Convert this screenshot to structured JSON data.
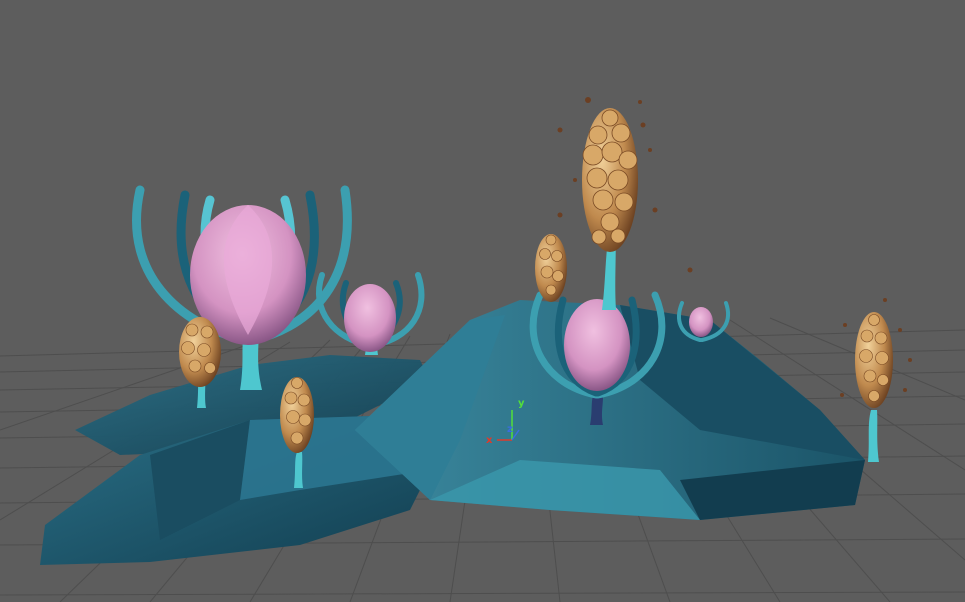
{
  "viewport": {
    "background": "#5d5d5d",
    "grid_color": "#4e4e4e",
    "rock_color": "#1f5d73",
    "stem_color": "#4ec7cf",
    "bulb_color": "#d493c2",
    "cone_color": "#b07a45"
  },
  "axis_gizmo": {
    "x_label": "x",
    "y_label": "y",
    "z_label": "z",
    "x_color": "#e03a2a",
    "y_color": "#53e03a",
    "z_color": "#3a6de0"
  },
  "objects": [
    {
      "name": "lotus-plant",
      "count": 4
    },
    {
      "name": "seed-cone-plant",
      "count": 5
    }
  ]
}
